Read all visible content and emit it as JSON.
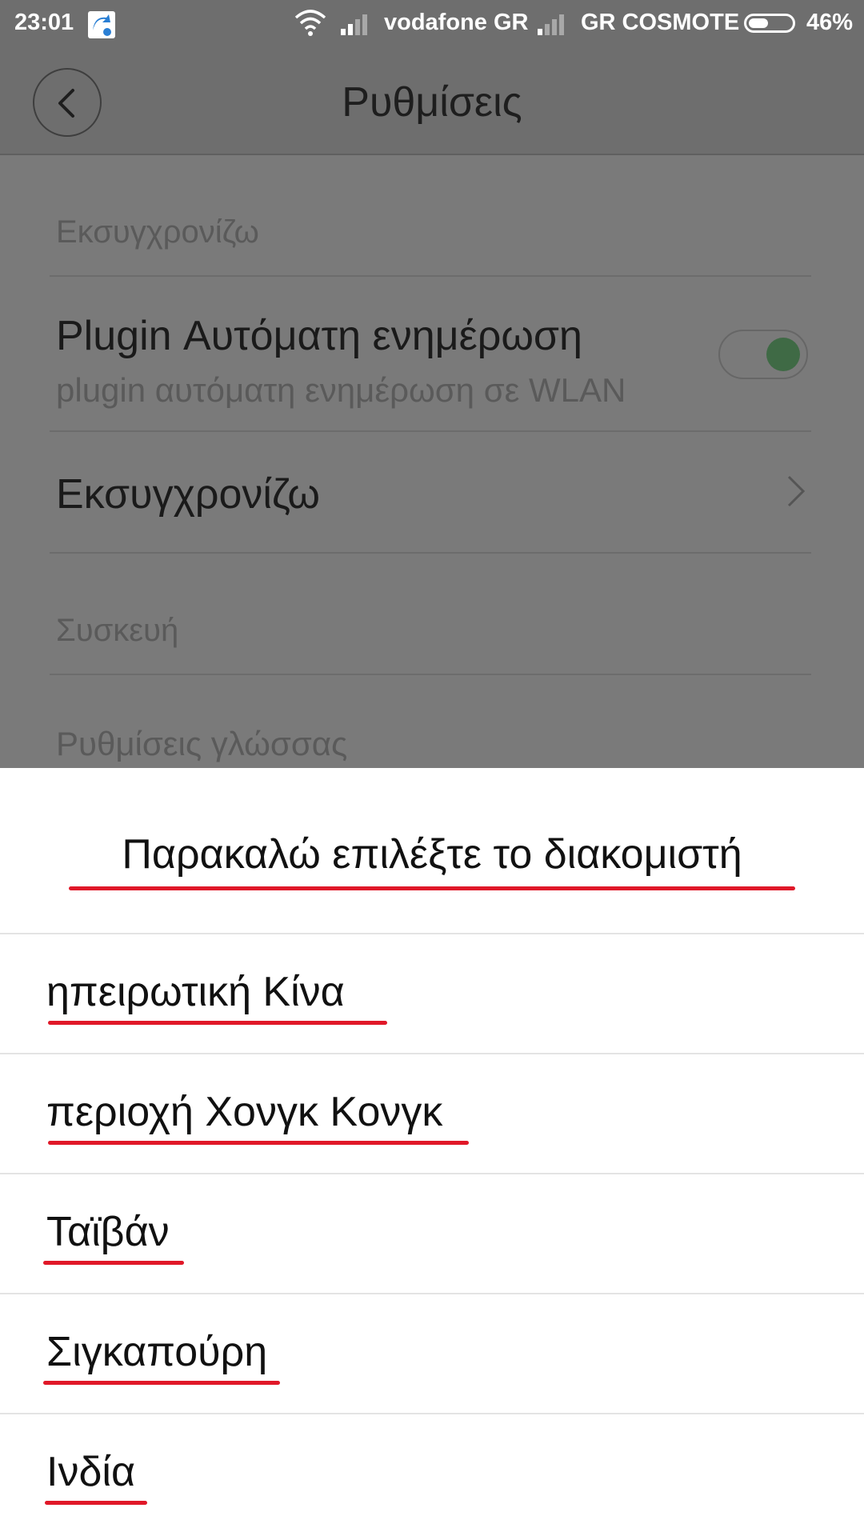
{
  "status_bar": {
    "time": "23:01",
    "carrier1": "vodafone GR",
    "carrier2": "GR COSMOTE",
    "battery_percent": "46%",
    "battery_level": 0.46,
    "icons": [
      "app-notification-icon",
      "wifi-icon",
      "signal-icon",
      "signal-icon",
      "battery-icon"
    ]
  },
  "header": {
    "title": "Ρυθμίσεις",
    "back_icon": "chevron-left-icon"
  },
  "settings": {
    "section_sync": "Εκσυγχρονίζω",
    "plugin_auto_update": {
      "title": "Plugin Αυτόματη ενημέρωση",
      "subtitle": "plugin αυτόματη ενημέρωση σε WLAN",
      "enabled": true
    },
    "sync_item": "Εκσυγχρονίζω",
    "section_device": "Συσκευή",
    "language_settings": "Ρυθμίσεις γλώσσας"
  },
  "dialog": {
    "title": "Παρακαλώ επιλέξτε το διακομιστή",
    "options": [
      "ηπειρωτική Κίνα",
      "περιοχή Χονγκ Κονγκ",
      "Ταϊβάν",
      "Σιγκαπούρη",
      "Ινδία"
    ]
  },
  "colors": {
    "accent_underline": "#e01828",
    "toggle_on": "#3f6a45",
    "dim_background": "#7a7a7a"
  }
}
